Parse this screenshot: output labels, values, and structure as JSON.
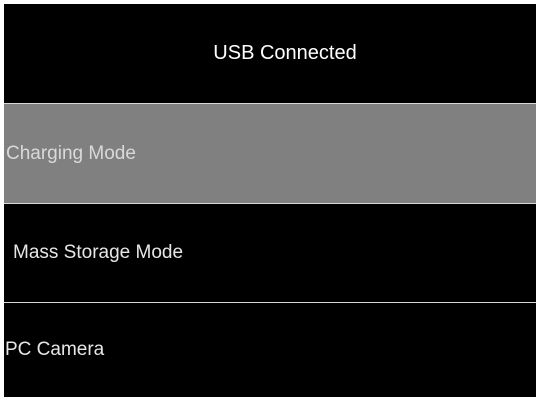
{
  "header": {
    "title": "USB Connected"
  },
  "menu": {
    "items": [
      {
        "label": "Charging Mode",
        "selected": true
      },
      {
        "label": "Mass Storage Mode",
        "selected": false
      },
      {
        "label": "PC Camera",
        "selected": false
      }
    ]
  },
  "colors": {
    "background": "#000000",
    "selected_background": "#808080",
    "text": "#e6e6e6",
    "divider": "#d8d8d8"
  }
}
